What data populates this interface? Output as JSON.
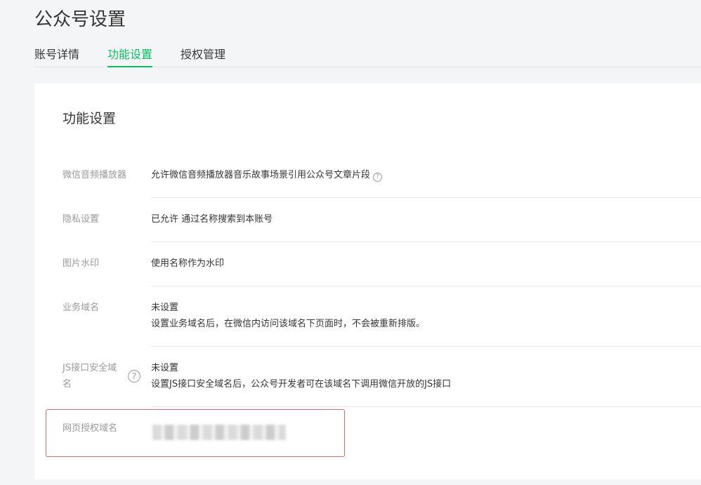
{
  "page": {
    "title": "公众号设置"
  },
  "tabs": [
    {
      "label": "账号详情",
      "active": false
    },
    {
      "label": "功能设置",
      "active": true
    },
    {
      "label": "授权管理",
      "active": false
    }
  ],
  "card": {
    "title": "功能设置",
    "rows": [
      {
        "label": "微信音频播放器",
        "value": "允许微信音频播放器音乐故事场景引用公众号文章片段",
        "help": "?"
      },
      {
        "label": "隐私设置",
        "value": "已允许 通过名称搜索到本账号"
      },
      {
        "label": "图片水印",
        "value": "使用名称作为水印"
      },
      {
        "label": "业务域名",
        "status": "未设置",
        "description": "设置业务域名后，在微信内访问该域名下页面时，不会被重新排版。"
      },
      {
        "label_line1": "JS接口安全域",
        "label_line2": "名",
        "status": "未设置",
        "description": "设置JS接口安全域名后，公众号开发者可在该域名下调用微信开放的JS接口",
        "help": "?"
      },
      {
        "label": "网页授权域名"
      }
    ]
  },
  "colors": {
    "accent": "#07c160",
    "highlight_border": "#e06a6a",
    "label": "#9a9a9a",
    "text": "#353535",
    "background": "#f4f5f6"
  }
}
